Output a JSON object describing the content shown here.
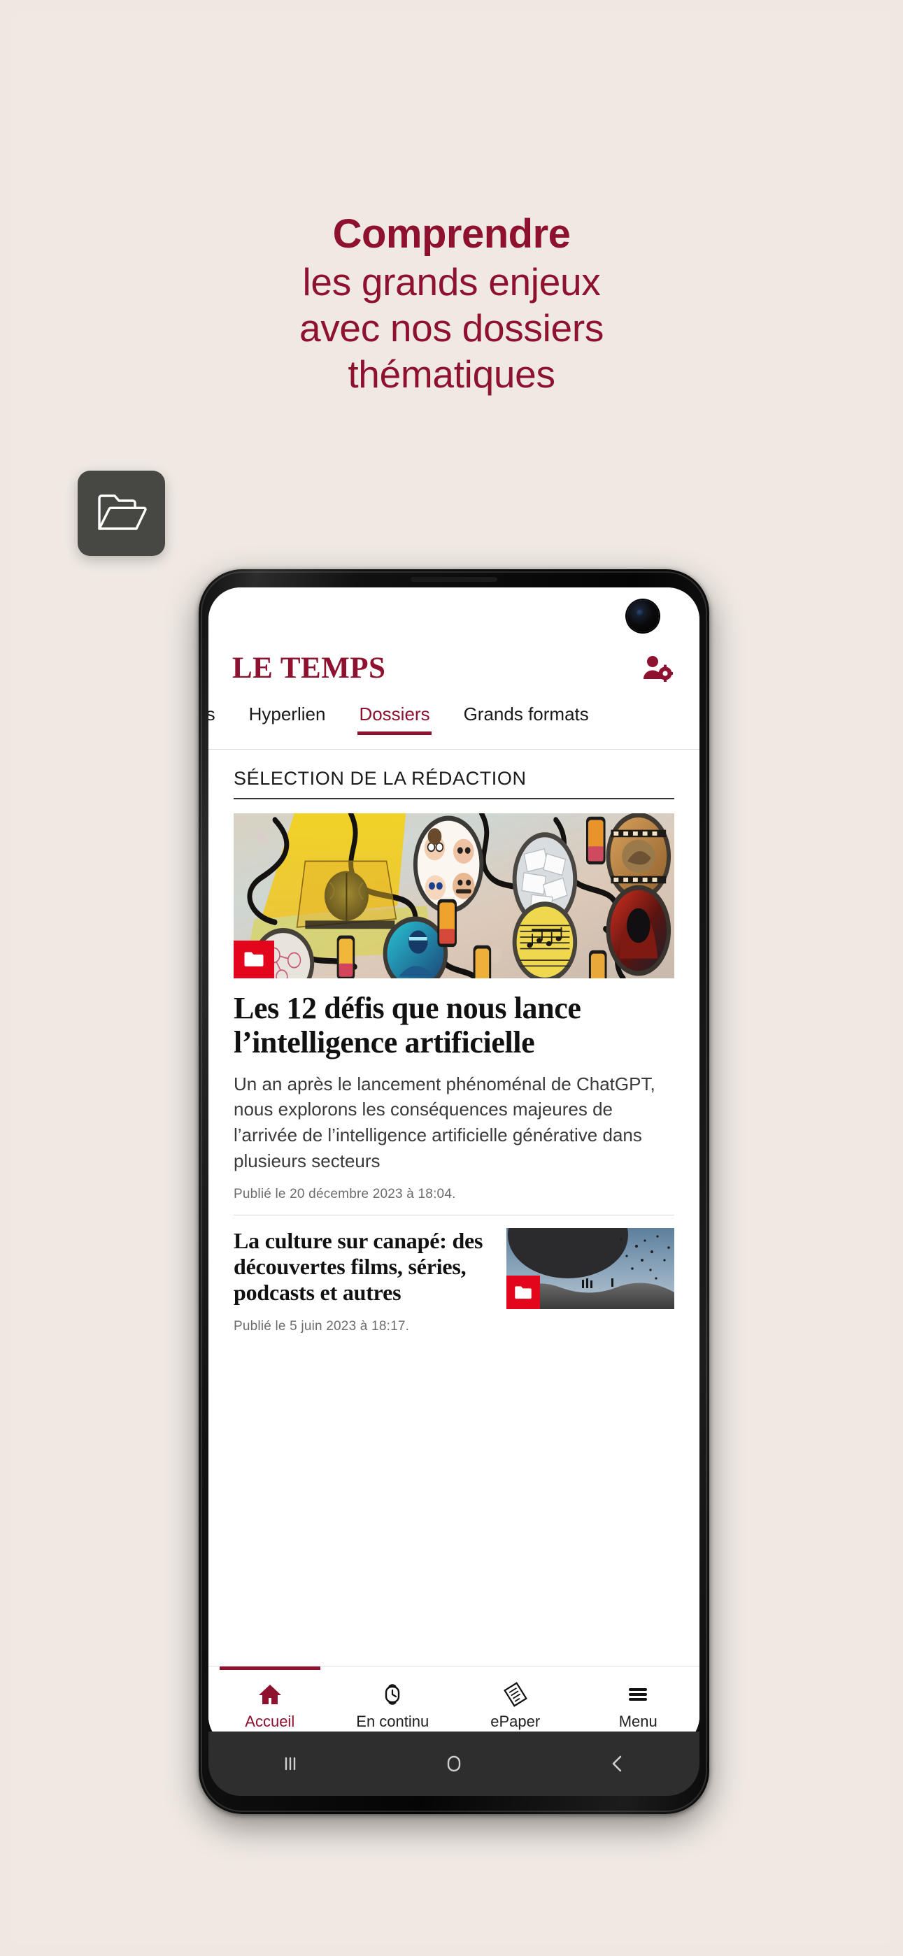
{
  "promo": {
    "headline_lines": [
      {
        "text": "Comprendre",
        "weight": "bold"
      },
      {
        "text": "les grands enjeux",
        "weight": "regular"
      },
      {
        "text": "avec nos dossiers",
        "weight": "regular"
      },
      {
        "text": "thématiques",
        "weight": "regular"
      }
    ],
    "brand_color": "#8e1230",
    "background_color": "#f0e9e3"
  },
  "app": {
    "brand": "LE TEMPS",
    "account_icon": "user-gear-icon",
    "tabs": [
      {
        "label": "nents",
        "active": false
      },
      {
        "label": "Hyperlien",
        "active": false
      },
      {
        "label": "Dossiers",
        "active": true
      },
      {
        "label": "Grands formats",
        "active": false
      }
    ],
    "section_title": "SÉLECTION DE LA RÉDACTION",
    "hero_article": {
      "title": "Les 12 défis que nous lance l’intelligence artificielle",
      "lead": "Un an après le lancement phénoménal de ChatGPT, nous explorons les conséquences majeures de l’arrivée de l’intelligence artificielle générative dans plusieurs secteurs",
      "date": "Publié le 20 décembre 2023 à 18:04.",
      "badge_icon": "folder-icon",
      "badge_color": "#e3051b"
    },
    "second_article": {
      "title": "La culture sur canapé: des découvertes films, séries, podcasts et autres",
      "date": "Publié le 5 juin 2023 à 18:17.",
      "badge_icon": "folder-icon",
      "badge_color": "#e3051b"
    },
    "bottom_nav": [
      {
        "label": "Accueil",
        "icon": "home-icon",
        "active": true
      },
      {
        "label": "En continu",
        "icon": "watch-clock-icon",
        "active": false
      },
      {
        "label": "ePaper",
        "icon": "newspaper-icon",
        "active": false
      },
      {
        "label": "Menu",
        "icon": "hamburger-menu-icon",
        "active": false
      }
    ]
  },
  "system_nav": [
    {
      "icon": "recents-icon"
    },
    {
      "icon": "home-square-icon"
    },
    {
      "icon": "back-chevron-icon"
    }
  ],
  "overlay": {
    "icon": "open-folder-icon"
  }
}
